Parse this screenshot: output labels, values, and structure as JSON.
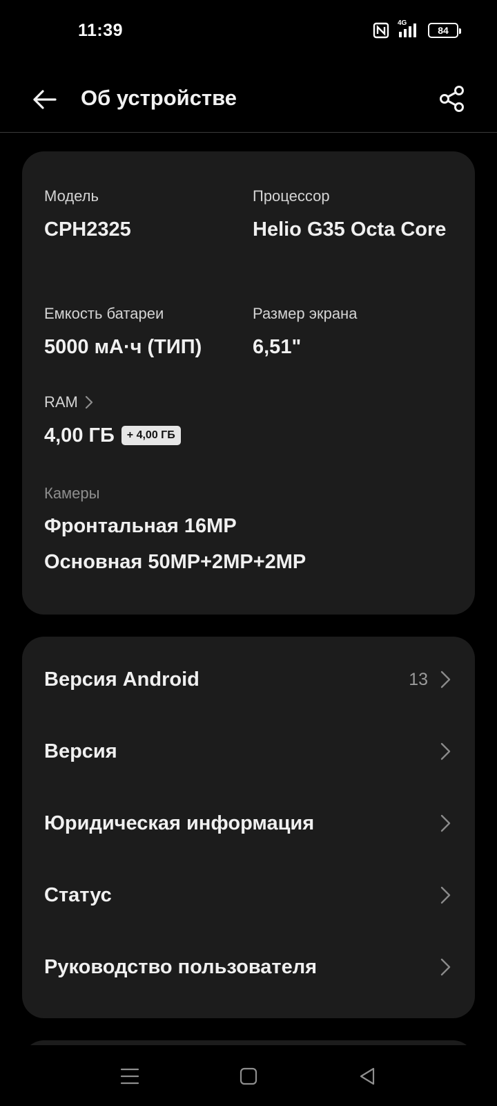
{
  "status": {
    "time": "11:39",
    "network": "4G",
    "battery": "84",
    "icons": [
      "nfc-icon",
      "signal-icon",
      "battery-icon"
    ]
  },
  "header": {
    "title": "Об устройстве",
    "back_icon": "arrow-left-icon",
    "share_icon": "share-icon"
  },
  "specs": {
    "model": {
      "label": "Модель",
      "value": "CPH2325"
    },
    "processor": {
      "label": "Процессор",
      "value": "Helio G35 Octa Core"
    },
    "battery": {
      "label": "Емкость батареи",
      "value": "5000 мА·ч (ТИП)"
    },
    "screen": {
      "label": "Размер экрана",
      "value": "6,51\""
    },
    "ram": {
      "label": "RAM",
      "value": "4,00 ГБ",
      "extra": "+ 4,00 ГБ"
    },
    "cameras": {
      "label": "Камеры",
      "front": "Фронтальная 16MP",
      "main": "Основная 50MP+2MP+2MP"
    }
  },
  "menu": {
    "items": [
      {
        "label": "Версия Android",
        "value": "13"
      },
      {
        "label": "Версия",
        "value": ""
      },
      {
        "label": "Юридическая информация",
        "value": ""
      },
      {
        "label": "Статус",
        "value": ""
      },
      {
        "label": "Руководство пользователя",
        "value": ""
      }
    ]
  },
  "navbar": {
    "icons": [
      "menu-icon",
      "home-icon",
      "back-triangle-icon"
    ]
  },
  "colors": {
    "background": "#000000",
    "card": "#1c1c1c",
    "text_primary": "#f0f0f0",
    "text_secondary": "#8e8e8e"
  }
}
